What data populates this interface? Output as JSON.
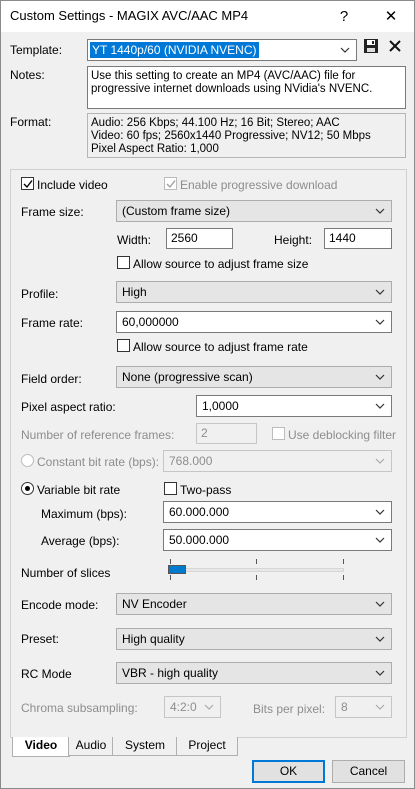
{
  "window": {
    "title": "Custom Settings - MAGIX AVC/AAC MP4",
    "help_label": "?",
    "close_label": "✕"
  },
  "template": {
    "label": "Template:",
    "value": "YT 1440p/60 (NVIDIA NVENC)"
  },
  "notes": {
    "label": "Notes:",
    "text": "Use this setting to create an MP4 (AVC/AAC) file for progressive internet downloads using NVidia's NVENC."
  },
  "format": {
    "label": "Format:",
    "line1": "Audio: 256 Kbps; 44.100 Hz; 16 Bit; Stereo; AAC",
    "line2": "Video: 60 fps; 2560x1440 Progressive; NV12; 50 Mbps",
    "line3": "Pixel Aspect Ratio: 1,000"
  },
  "video": {
    "include_video": {
      "label": "Include video",
      "checked": true
    },
    "progressive_download": {
      "label": "Enable progressive download",
      "checked": true
    },
    "frame_size": {
      "label": "Frame size:",
      "value": "(Custom frame size)"
    },
    "width": {
      "label": "Width:",
      "value": "2560"
    },
    "height": {
      "label": "Height:",
      "value": "1440"
    },
    "allow_frame_size": {
      "label": "Allow source to adjust frame size"
    },
    "profile": {
      "label": "Profile:",
      "value": "High"
    },
    "frame_rate": {
      "label": "Frame rate:",
      "value": "60,000000"
    },
    "allow_frame_rate": {
      "label": "Allow source to adjust frame rate"
    },
    "field_order": {
      "label": "Field order:",
      "value": "None (progressive scan)"
    },
    "pixel_aspect": {
      "label": "Pixel aspect ratio:",
      "value": "1,0000"
    },
    "ref_frames": {
      "label": "Number of reference frames:",
      "value": "2"
    },
    "deblocking": {
      "label": "Use deblocking filter"
    },
    "constant_bitrate": {
      "label": "Constant bit rate (bps):",
      "value": "768.000"
    },
    "variable_bitrate": {
      "label": "Variable bit rate",
      "selected": true
    },
    "two_pass": {
      "label": "Two-pass"
    },
    "maximum": {
      "label": "Maximum (bps):",
      "value": "60.000.000"
    },
    "average": {
      "label": "Average (bps):",
      "value": "50.000.000"
    },
    "slices": {
      "label": "Number of slices"
    },
    "encode_mode": {
      "label": "Encode mode:",
      "value": "NV Encoder"
    },
    "preset": {
      "label": "Preset:",
      "value": "High quality"
    },
    "rc_mode": {
      "label": "RC Mode",
      "value": "VBR - high quality"
    },
    "chroma": {
      "label": "Chroma subsampling:",
      "value": "4:2:0"
    },
    "bits_per_pixel": {
      "label": "Bits per pixel:",
      "value": "8"
    }
  },
  "tabs": [
    {
      "label": "Video",
      "active": true
    },
    {
      "label": "Audio",
      "active": false
    },
    {
      "label": "System",
      "active": false
    },
    {
      "label": "Project",
      "active": false
    }
  ],
  "buttons": {
    "ok": "OK",
    "cancel": "Cancel"
  },
  "colors": {
    "selection": "#0078d7",
    "accent_border": "#0078d7"
  }
}
